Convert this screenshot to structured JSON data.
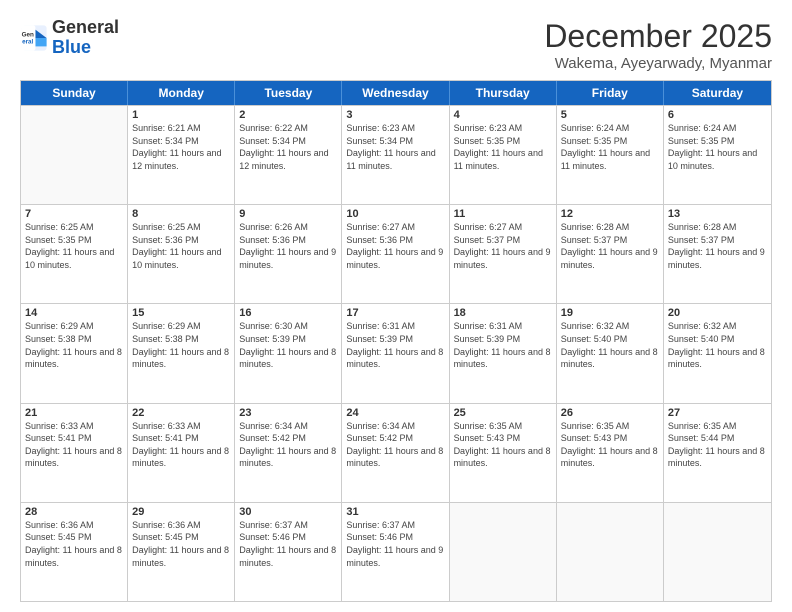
{
  "logo": {
    "line1": "General",
    "line2": "Blue"
  },
  "title": "December 2025",
  "subtitle": "Wakema, Ayeyarwady, Myanmar",
  "days": [
    "Sunday",
    "Monday",
    "Tuesday",
    "Wednesday",
    "Thursday",
    "Friday",
    "Saturday"
  ],
  "weeks": [
    [
      {
        "date": "",
        "info": ""
      },
      {
        "date": "1",
        "info": "Sunrise: 6:21 AM\nSunset: 5:34 PM\nDaylight: 11 hours and 12 minutes."
      },
      {
        "date": "2",
        "info": "Sunrise: 6:22 AM\nSunset: 5:34 PM\nDaylight: 11 hours and 12 minutes."
      },
      {
        "date": "3",
        "info": "Sunrise: 6:23 AM\nSunset: 5:34 PM\nDaylight: 11 hours and 11 minutes."
      },
      {
        "date": "4",
        "info": "Sunrise: 6:23 AM\nSunset: 5:35 PM\nDaylight: 11 hours and 11 minutes."
      },
      {
        "date": "5",
        "info": "Sunrise: 6:24 AM\nSunset: 5:35 PM\nDaylight: 11 hours and 11 minutes."
      },
      {
        "date": "6",
        "info": "Sunrise: 6:24 AM\nSunset: 5:35 PM\nDaylight: 11 hours and 10 minutes."
      }
    ],
    [
      {
        "date": "7",
        "info": "Sunrise: 6:25 AM\nSunset: 5:35 PM\nDaylight: 11 hours and 10 minutes."
      },
      {
        "date": "8",
        "info": "Sunrise: 6:25 AM\nSunset: 5:36 PM\nDaylight: 11 hours and 10 minutes."
      },
      {
        "date": "9",
        "info": "Sunrise: 6:26 AM\nSunset: 5:36 PM\nDaylight: 11 hours and 9 minutes."
      },
      {
        "date": "10",
        "info": "Sunrise: 6:27 AM\nSunset: 5:36 PM\nDaylight: 11 hours and 9 minutes."
      },
      {
        "date": "11",
        "info": "Sunrise: 6:27 AM\nSunset: 5:37 PM\nDaylight: 11 hours and 9 minutes."
      },
      {
        "date": "12",
        "info": "Sunrise: 6:28 AM\nSunset: 5:37 PM\nDaylight: 11 hours and 9 minutes."
      },
      {
        "date": "13",
        "info": "Sunrise: 6:28 AM\nSunset: 5:37 PM\nDaylight: 11 hours and 9 minutes."
      }
    ],
    [
      {
        "date": "14",
        "info": "Sunrise: 6:29 AM\nSunset: 5:38 PM\nDaylight: 11 hours and 8 minutes."
      },
      {
        "date": "15",
        "info": "Sunrise: 6:29 AM\nSunset: 5:38 PM\nDaylight: 11 hours and 8 minutes."
      },
      {
        "date": "16",
        "info": "Sunrise: 6:30 AM\nSunset: 5:39 PM\nDaylight: 11 hours and 8 minutes."
      },
      {
        "date": "17",
        "info": "Sunrise: 6:31 AM\nSunset: 5:39 PM\nDaylight: 11 hours and 8 minutes."
      },
      {
        "date": "18",
        "info": "Sunrise: 6:31 AM\nSunset: 5:39 PM\nDaylight: 11 hours and 8 minutes."
      },
      {
        "date": "19",
        "info": "Sunrise: 6:32 AM\nSunset: 5:40 PM\nDaylight: 11 hours and 8 minutes."
      },
      {
        "date": "20",
        "info": "Sunrise: 6:32 AM\nSunset: 5:40 PM\nDaylight: 11 hours and 8 minutes."
      }
    ],
    [
      {
        "date": "21",
        "info": "Sunrise: 6:33 AM\nSunset: 5:41 PM\nDaylight: 11 hours and 8 minutes."
      },
      {
        "date": "22",
        "info": "Sunrise: 6:33 AM\nSunset: 5:41 PM\nDaylight: 11 hours and 8 minutes."
      },
      {
        "date": "23",
        "info": "Sunrise: 6:34 AM\nSunset: 5:42 PM\nDaylight: 11 hours and 8 minutes."
      },
      {
        "date": "24",
        "info": "Sunrise: 6:34 AM\nSunset: 5:42 PM\nDaylight: 11 hours and 8 minutes."
      },
      {
        "date": "25",
        "info": "Sunrise: 6:35 AM\nSunset: 5:43 PM\nDaylight: 11 hours and 8 minutes."
      },
      {
        "date": "26",
        "info": "Sunrise: 6:35 AM\nSunset: 5:43 PM\nDaylight: 11 hours and 8 minutes."
      },
      {
        "date": "27",
        "info": "Sunrise: 6:35 AM\nSunset: 5:44 PM\nDaylight: 11 hours and 8 minutes."
      }
    ],
    [
      {
        "date": "28",
        "info": "Sunrise: 6:36 AM\nSunset: 5:45 PM\nDaylight: 11 hours and 8 minutes."
      },
      {
        "date": "29",
        "info": "Sunrise: 6:36 AM\nSunset: 5:45 PM\nDaylight: 11 hours and 8 minutes."
      },
      {
        "date": "30",
        "info": "Sunrise: 6:37 AM\nSunset: 5:46 PM\nDaylight: 11 hours and 8 minutes."
      },
      {
        "date": "31",
        "info": "Sunrise: 6:37 AM\nSunset: 5:46 PM\nDaylight: 11 hours and 9 minutes."
      },
      {
        "date": "",
        "info": ""
      },
      {
        "date": "",
        "info": ""
      },
      {
        "date": "",
        "info": ""
      }
    ]
  ]
}
